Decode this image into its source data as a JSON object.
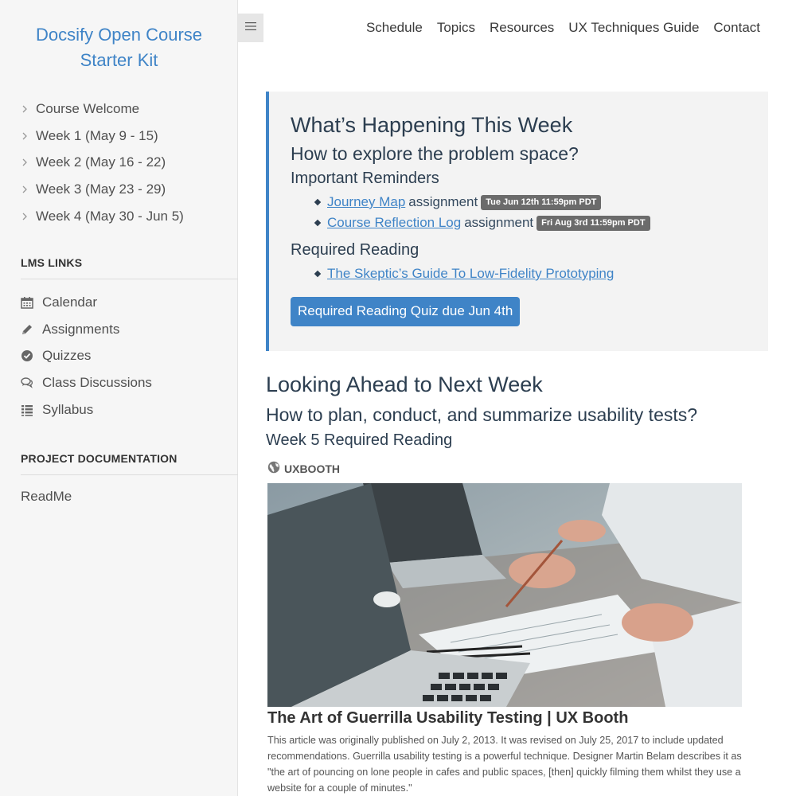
{
  "sidebar": {
    "app_name_line1": "Docsify Open Course",
    "app_name_line2": "Starter Kit",
    "weeks": [
      {
        "label": "Course Welcome"
      },
      {
        "label": "Week 1 (May 9 - 15)"
      },
      {
        "label": "Week 2 (May 16 - 22)"
      },
      {
        "label": "Week 3 (May 23 - 29)"
      },
      {
        "label": "Week 4 (May 30 - Jun 5)"
      }
    ],
    "lms_title": "LMS LINKS",
    "lms_links": [
      {
        "label": "Calendar",
        "icon": "calendar-icon"
      },
      {
        "label": "Assignments",
        "icon": "pencil-icon"
      },
      {
        "label": "Quizzes",
        "icon": "check-circle-icon"
      },
      {
        "label": "Class Discussions",
        "icon": "comments-icon"
      },
      {
        "label": "Syllabus",
        "icon": "list-icon"
      }
    ],
    "docs_title": "PROJECT DOCUMENTATION",
    "docs_links": [
      {
        "label": "ReadMe"
      }
    ]
  },
  "nav": [
    {
      "label": "Schedule"
    },
    {
      "label": "Topics"
    },
    {
      "label": "Resources"
    },
    {
      "label": "UX Techniques Guide"
    },
    {
      "label": "Contact"
    }
  ],
  "this_week": {
    "title": "What’s Happening This Week",
    "question": "How to explore the problem space?",
    "reminders_title": "Important Reminders",
    "reminders": [
      {
        "link": "Journey Map",
        "suffix": "assignment",
        "badge": "Tue Jun 12th 11:59pm PDT"
      },
      {
        "link": "Course Reflection Log",
        "suffix": "assignment",
        "badge": "Fri Aug 3rd 11:59pm PDT"
      }
    ],
    "reading_title": "Required Reading",
    "readings": [
      {
        "link": "The Skeptic’s Guide To Low-Fidelity Prototyping"
      }
    ],
    "quiz_button": "Required Reading Quiz due Jun 4th"
  },
  "next_week": {
    "title": "Looking Ahead to Next Week",
    "question": "How to plan, conduct, and summarize usability tests?",
    "reading_title": "Week 5 Required Reading",
    "source": "UXBOOTH",
    "article_title": "The Art of Guerrilla Usability Testing | UX Booth",
    "article_desc": "This article was originally published on July 2, 2013. It was revised on July 25, 2017 to include updated recommendations. Guerrilla usability testing is a powerful technique. Designer Martin Belam describes it as \"the art of pouncing on lone people in cafes and public spaces, [then] quickly filming them whilst they use a website for a couple of minutes.\""
  },
  "colors": {
    "accent": "#3f84c7",
    "sidebar_bg": "#f6f6f6",
    "callout_bg": "#f3f3f3",
    "badge_bg": "#6b6b6b"
  }
}
